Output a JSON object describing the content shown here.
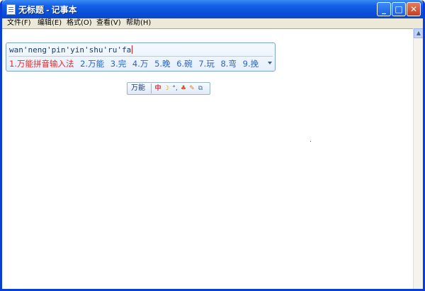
{
  "window": {
    "title": "无标题 - 记事本",
    "minimize_glyph": "_",
    "maximize_glyph": "□",
    "close_glyph": "✕"
  },
  "menubar": {
    "items": [
      "文件(F)",
      "编辑(E)",
      "格式(O)",
      "查看(V)",
      "帮助(H)"
    ]
  },
  "ime": {
    "pinyin": "wan'neng'pin'yin'shu'ru'fa",
    "candidates": [
      "1.万能拼音输入法",
      "2.万能",
      "3.完",
      "4.万",
      "5.晚",
      "6.碗",
      "7.玩",
      "8.弯",
      "9.挽"
    ],
    "status_name": "万能",
    "status_icons": [
      "中",
      "☽",
      "°,",
      "♣",
      "✎",
      "⧉"
    ],
    "colors": {
      "selected": "#e02b2b",
      "candidate": "#2a63c5"
    }
  }
}
